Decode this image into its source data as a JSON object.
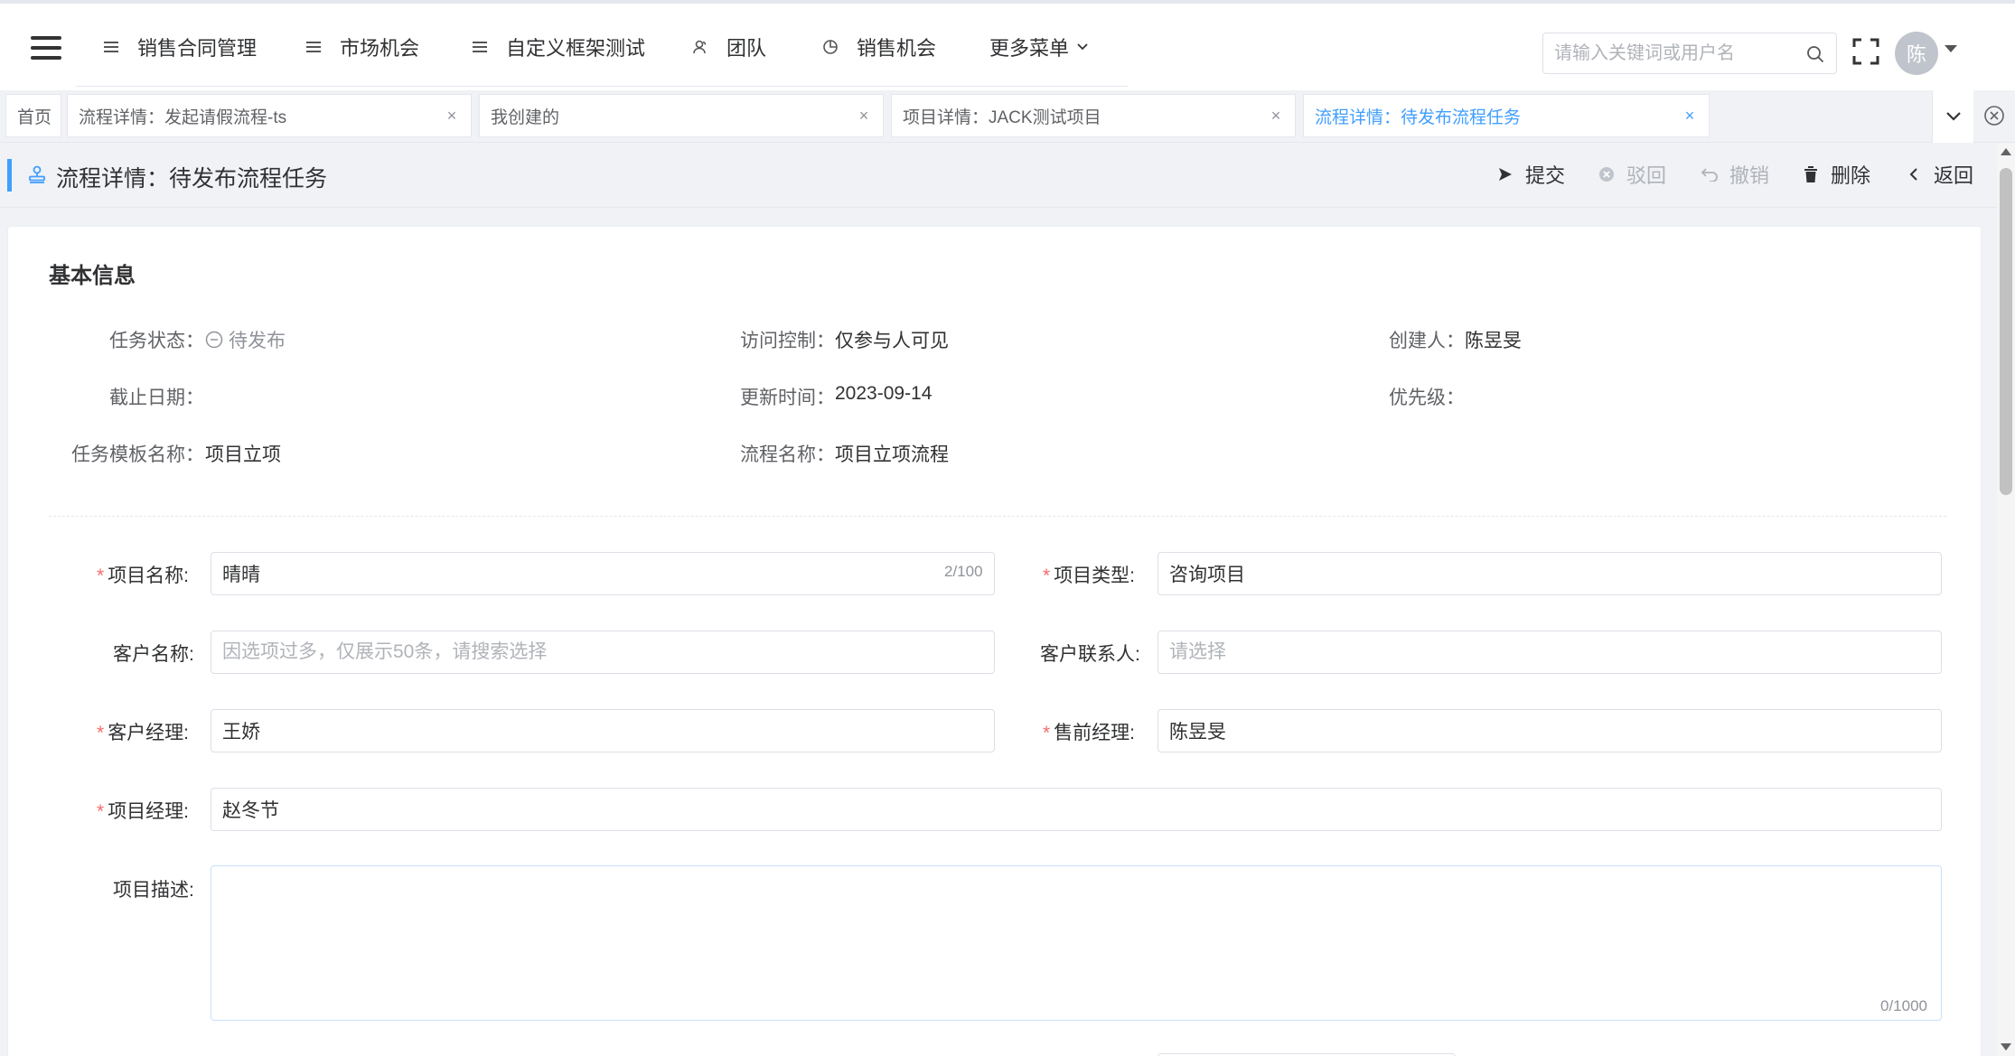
{
  "nav": {
    "menu": [
      {
        "label": "销售合同管理",
        "icon": "list-icon"
      },
      {
        "label": "市场机会",
        "icon": "list-icon"
      },
      {
        "label": "自定义框架测试",
        "icon": "list-icon"
      },
      {
        "label": "团队",
        "icon": "team-icon"
      },
      {
        "label": "销售机会",
        "icon": "pie-chart-icon"
      },
      {
        "label": "更多菜单",
        "icon": "chevron-down-icon"
      }
    ],
    "search_placeholder": "请输入关键词或用户名",
    "avatar_text": "陈"
  },
  "tabs": [
    {
      "label": "首页",
      "closable": false
    },
    {
      "label": "流程详情：发起请假流程-ts",
      "closable": true
    },
    {
      "label": "我创建的",
      "closable": true
    },
    {
      "label": "项目详情：JACK测试项目",
      "closable": true
    },
    {
      "label": "流程详情：待发布流程任务",
      "closable": true,
      "active": true
    }
  ],
  "page": {
    "title": "流程详情：待发布流程任务",
    "actions": {
      "submit": "提交",
      "reject": "驳回",
      "revoke": "撤销",
      "delete": "删除",
      "back": "返回"
    }
  },
  "basic_info": {
    "title": "基本信息",
    "task_status_label": "任务状态：",
    "task_status_value": "待发布",
    "access_label": "访问控制：",
    "access_value": "仅参与人可见",
    "creator_label": "创建人：",
    "creator_value": "陈昱旻",
    "deadline_label": "截止日期：",
    "updated_label": "更新时间：",
    "updated_value": "2023-09-14",
    "priority_label": "优先级：",
    "template_label": "任务模板名称：",
    "template_value": "项目立项",
    "flow_label": "流程名称：",
    "flow_value": "项目立项流程"
  },
  "form": {
    "project_name_label": "项目名称:",
    "project_name_value": "晴晴",
    "project_name_counter": "2/100",
    "project_type_label": "项目类型:",
    "project_type_value": "咨询项目",
    "customer_name_label": "客户名称:",
    "customer_name_placeholder": "因选项过多，仅展示50条，请搜索选择",
    "customer_contact_label": "客户联系人:",
    "customer_contact_placeholder": "请选择",
    "account_manager_label": "客户经理:",
    "account_manager_value": "王娇",
    "presales_manager_label": "售前经理:",
    "presales_manager_value": "陈昱旻",
    "project_manager_label": "项目经理:",
    "project_manager_value": "赵冬节",
    "description_label": "项目描述:",
    "description_counter": "0/1000"
  },
  "colors": {
    "accent": "#409eff",
    "required": "#f56c6c",
    "disabled": "#b0b3b8"
  }
}
